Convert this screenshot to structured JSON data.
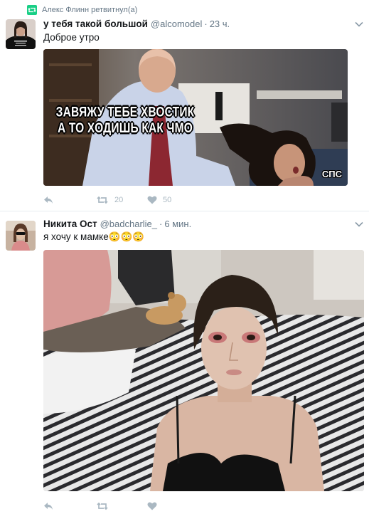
{
  "tweet1": {
    "retweet_label": "Алекс Флинн ретвитнул(а)",
    "fullname": "у тебя такой большой",
    "handle": "@alcomodel",
    "separator": "·",
    "time": "23 ч.",
    "text": "Доброе утро",
    "meme_caption_line1": "ЗАВЯЖУ ТЕБЕ ХВОСТИК",
    "meme_caption_line2": "А ТО ХОДИШЬ КАК ЧМО",
    "meme_corner": "СПС",
    "avatar_shirt_text": "I'M SO TIRED OF THIS BULLSHIT",
    "retweet_count": "20",
    "like_count": "50",
    "icons": {
      "reply": "reply-icon",
      "retweet": "retweet-icon",
      "like": "heart-icon",
      "more": "chevron-down-icon"
    }
  },
  "tweet2": {
    "fullname": "Никита Ост",
    "handle": "@badcharlie_",
    "separator": "·",
    "time": "6 мин.",
    "text": "я хочу к мамке😳😳😳",
    "icons": {
      "reply": "reply-icon",
      "retweet": "retweet-icon",
      "like": "heart-icon",
      "more": "chevron-down-icon"
    }
  },
  "colors": {
    "retweet_green": "#19cf86",
    "muted": "#657786",
    "action_gray": "#aab8c2"
  }
}
